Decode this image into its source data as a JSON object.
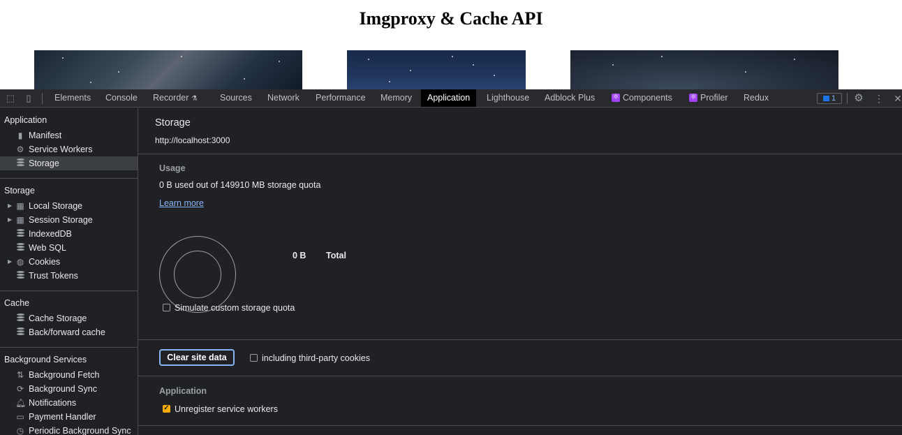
{
  "page": {
    "heading": "Imgproxy & Cache API"
  },
  "devtools": {
    "tabs": [
      {
        "label": "Elements"
      },
      {
        "label": "Console"
      },
      {
        "label": "Recorder"
      },
      {
        "label": "Sources"
      },
      {
        "label": "Network"
      },
      {
        "label": "Performance"
      },
      {
        "label": "Memory"
      },
      {
        "label": "Application"
      },
      {
        "label": "Lighthouse"
      },
      {
        "label": "Adblock Plus"
      },
      {
        "label": "Components"
      },
      {
        "label": "Profiler"
      },
      {
        "label": "Redux"
      }
    ],
    "active_tab": "Application",
    "issues_count": "1",
    "sidebar": {
      "application_title": "Application",
      "application_items": [
        {
          "label": "Manifest",
          "icon": "file-icon"
        },
        {
          "label": "Service Workers",
          "icon": "gear-icon"
        },
        {
          "label": "Storage",
          "icon": "database-icon"
        }
      ],
      "storage_title": "Storage",
      "storage_items": [
        {
          "label": "Local Storage",
          "icon": "grid-icon"
        },
        {
          "label": "Session Storage",
          "icon": "grid-icon"
        },
        {
          "label": "IndexedDB",
          "icon": "database-icon"
        },
        {
          "label": "Web SQL",
          "icon": "database-icon"
        },
        {
          "label": "Cookies",
          "icon": "cookie-icon"
        },
        {
          "label": "Trust Tokens",
          "icon": "database-icon"
        }
      ],
      "cache_title": "Cache",
      "cache_items": [
        {
          "label": "Cache Storage",
          "icon": "database-icon"
        },
        {
          "label": "Back/forward cache",
          "icon": "database-icon"
        }
      ],
      "bg_title": "Background Services",
      "bg_items": [
        {
          "label": "Background Fetch",
          "icon": "updown-arrows-icon"
        },
        {
          "label": "Background Sync",
          "icon": "sync-icon"
        },
        {
          "label": "Notifications",
          "icon": "bell-icon"
        },
        {
          "label": "Payment Handler",
          "icon": "card-icon"
        },
        {
          "label": "Periodic Background Sync",
          "icon": "clock-icon"
        }
      ]
    },
    "main": {
      "title": "Storage",
      "origin": "http://localhost:3000",
      "usage_heading": "Usage",
      "usage_text": "0 B used out of 149910 MB storage quota",
      "learn_more": "Learn more",
      "total_value": "0 B",
      "total_label": "Total",
      "simulate_quota_label": "Simulate custom storage quota",
      "simulate_quota_checked": false,
      "clear_button": "Clear site data",
      "third_party_label": "including third-party cookies",
      "third_party_checked": false,
      "application_heading": "Application",
      "unregister_label": "Unregister service workers",
      "unregister_checked": true
    }
  }
}
